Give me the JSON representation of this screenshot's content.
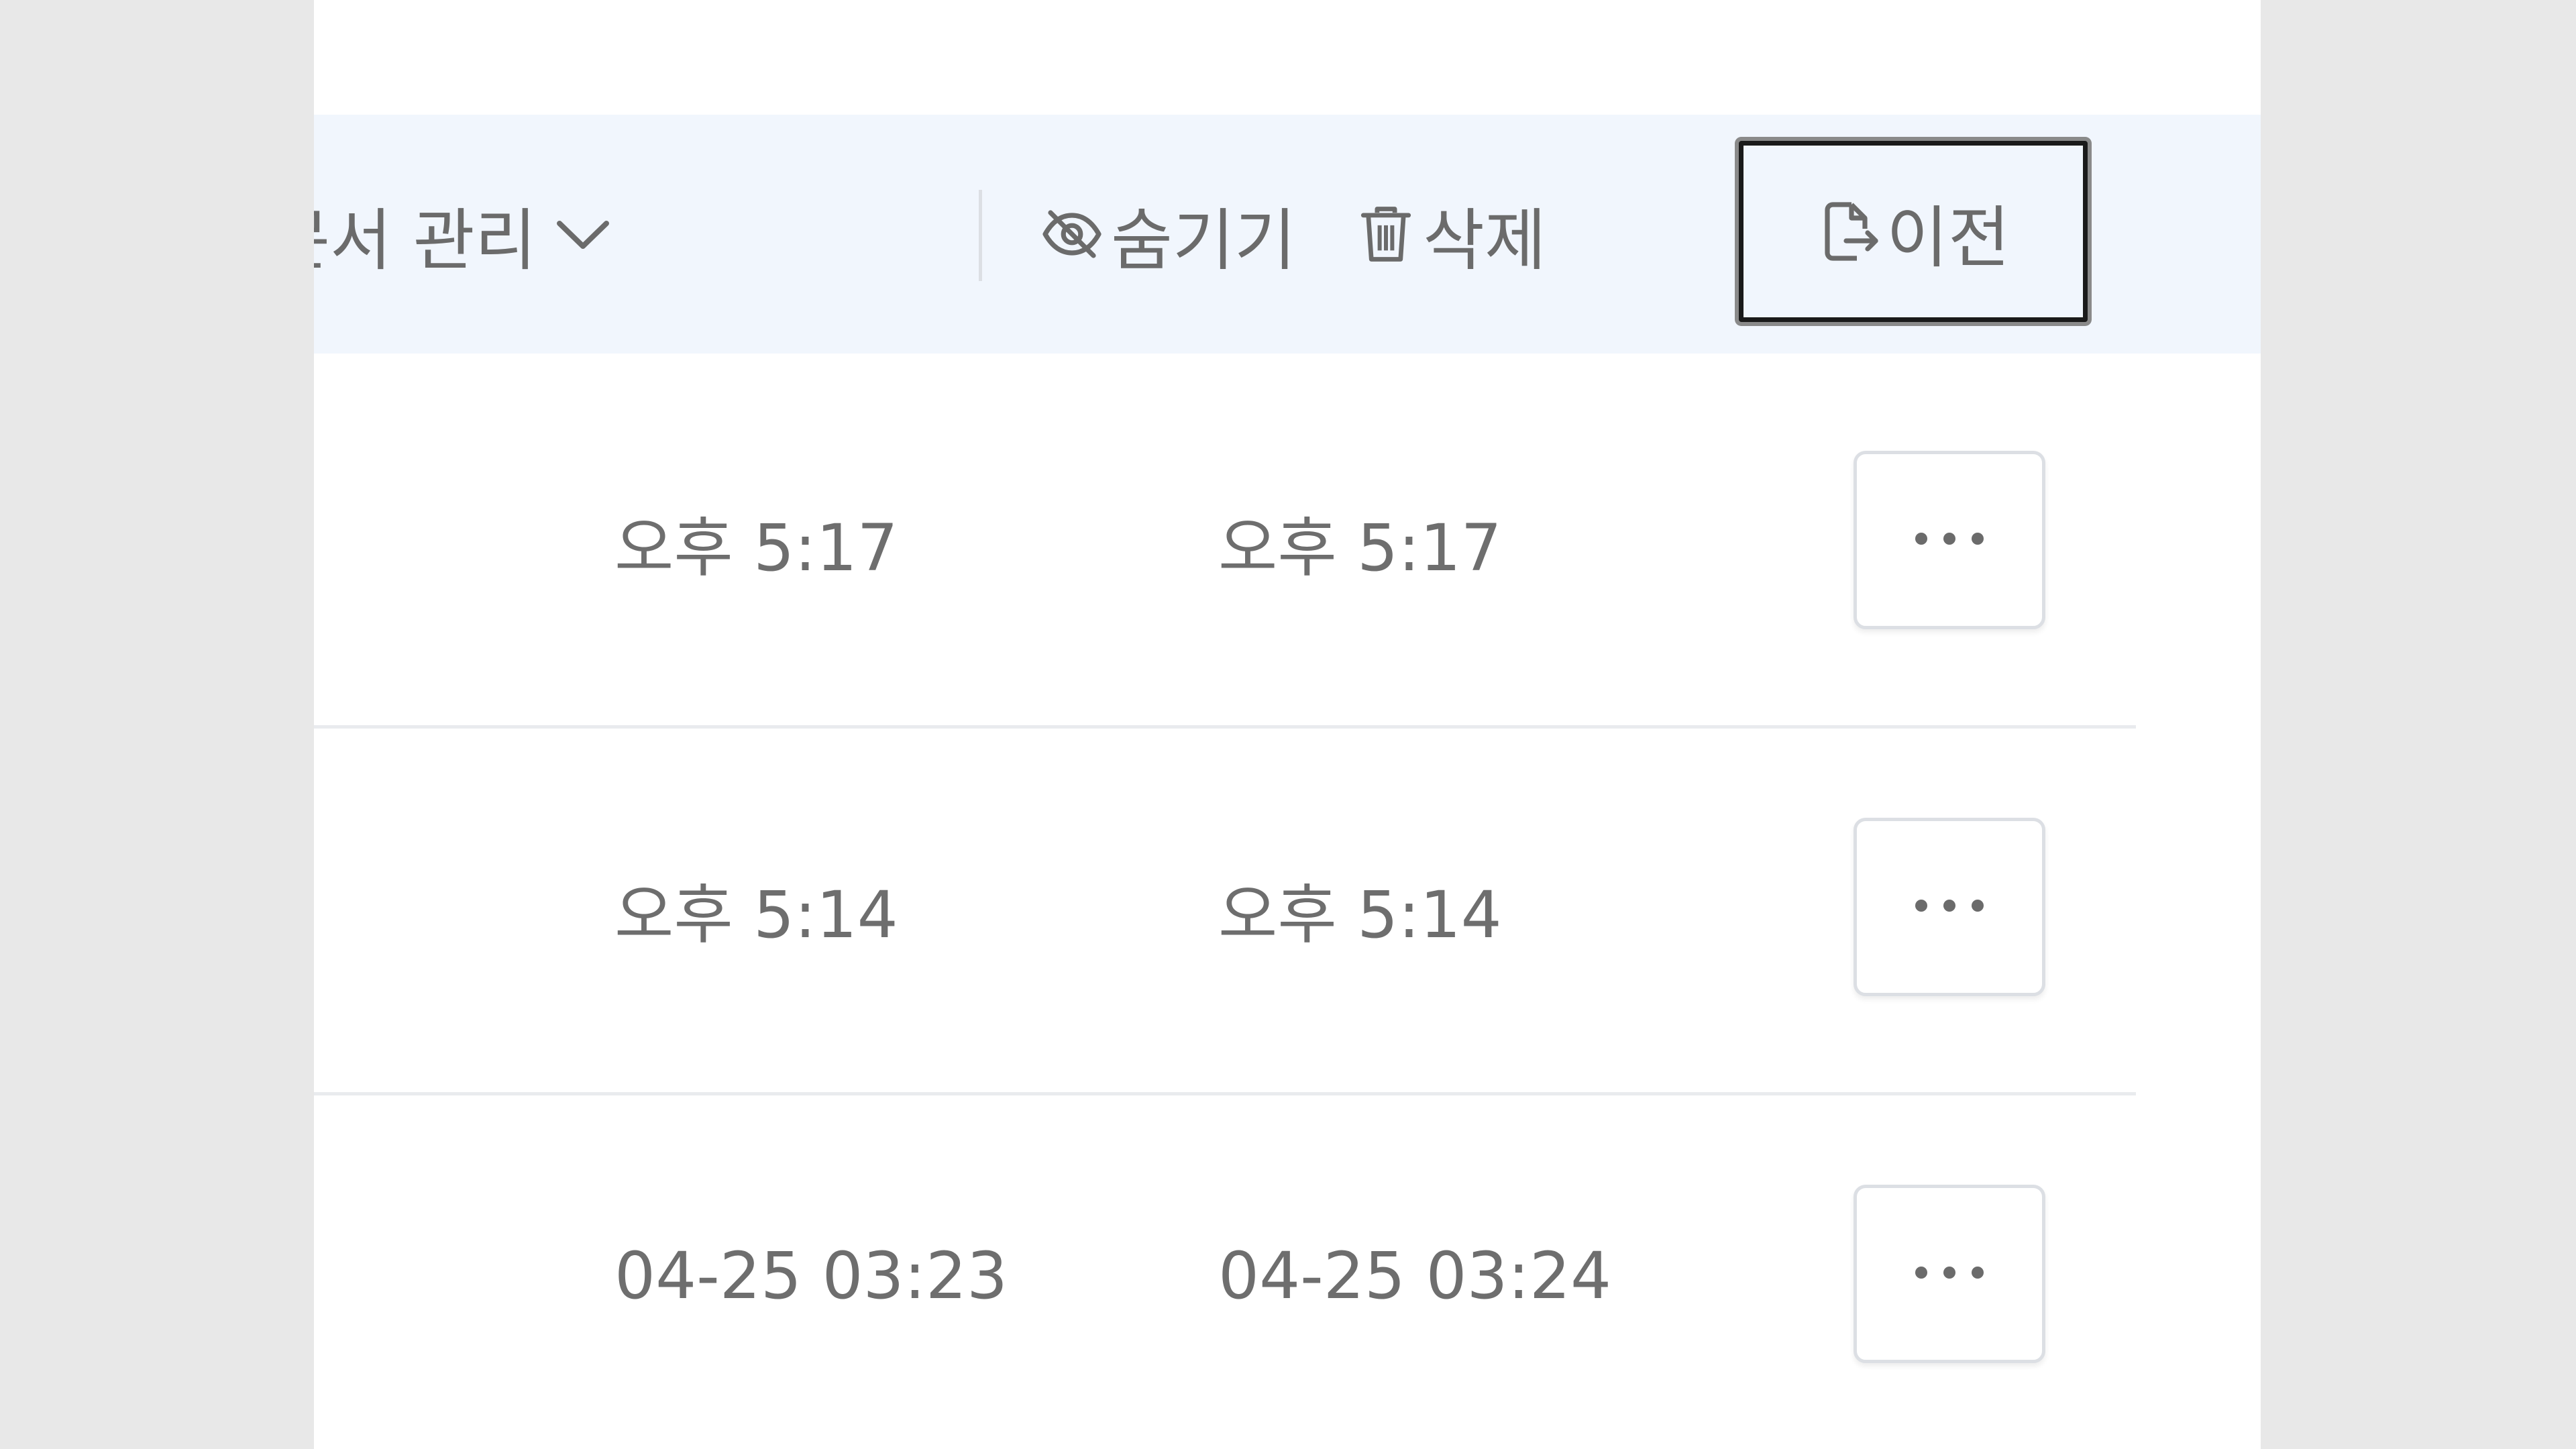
{
  "toolbar": {
    "manage_label": "문서 관리",
    "hide_label": "숨기기",
    "delete_label": "삭제",
    "move_label": "이전"
  },
  "rows": [
    {
      "created": "오후 5:17",
      "modified": "오후 5:17"
    },
    {
      "created": "오후 5:14",
      "modified": "오후 5:14"
    },
    {
      "created": "04-25 03:23",
      "modified": "04-25 03:24"
    }
  ],
  "icons": {
    "manage_dropdown": "chevron-down-icon",
    "hide": "eye-off-icon",
    "delete": "trash-icon",
    "move": "file-export-icon",
    "row_menu": "more-horizontal-icon"
  },
  "colors": {
    "toolbar_background": "#f1f6fd",
    "text": "#6b6b6b",
    "divider": "#e9ebee",
    "focus_border": "#1a1a1a"
  }
}
